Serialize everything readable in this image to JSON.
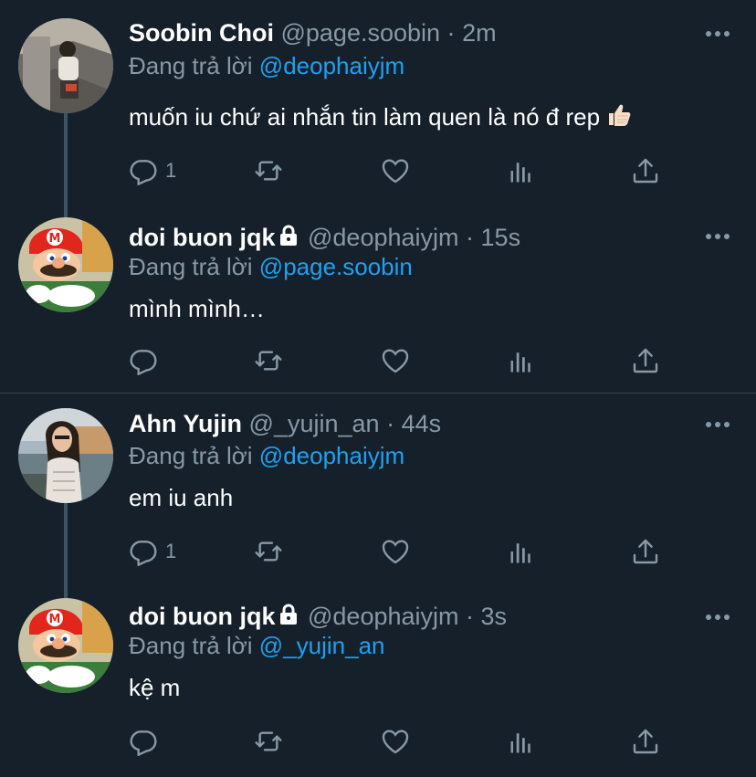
{
  "threads": [
    {
      "parent": {
        "name": "Soobin Choi",
        "handle": "@page.soobin",
        "separator": "·",
        "time": "2m",
        "reply_prefix": "Đang trả lời",
        "reply_to": "@deophaiyjm",
        "text": "muốn iu chứ ai nhắn tin làm quen là nó đ rep",
        "emoji": "thumbs-up-light-skin",
        "reply_count": "1"
      },
      "reply": {
        "name": "doi buon jqk",
        "handle": "@deophaiyjm",
        "separator": "·",
        "time": "15s",
        "reply_prefix": "Đang trả lời",
        "reply_to": "@page.soobin",
        "text": "mình mình…",
        "reply_count": ""
      }
    },
    {
      "parent": {
        "name": "Ahn Yujin",
        "handle": "@_yujin_an",
        "separator": "·",
        "time": "44s",
        "reply_prefix": "Đang trả lời",
        "reply_to": "@deophaiyjm",
        "text": "em iu anh",
        "reply_count": "1"
      },
      "reply": {
        "name": "doi buon jqk",
        "handle": "@deophaiyjm",
        "separator": "·",
        "time": "3s",
        "reply_prefix": "Đang trả lời",
        "reply_to": "@_yujin_an",
        "text": "kệ m",
        "reply_count": ""
      }
    }
  ],
  "icons": {
    "reply": "comment-icon",
    "retweet": "retweet-icon",
    "like": "heart-icon",
    "analytics": "analytics-icon",
    "share": "share-icon",
    "more": "more-options-icon",
    "protected": "lock-icon"
  },
  "colors": {
    "background": "#15202b",
    "primary_text": "#ffffff",
    "secondary_text": "#8899a6",
    "link": "#1da1f2",
    "thread_line": "#3d5466",
    "divider": "#38444d"
  }
}
